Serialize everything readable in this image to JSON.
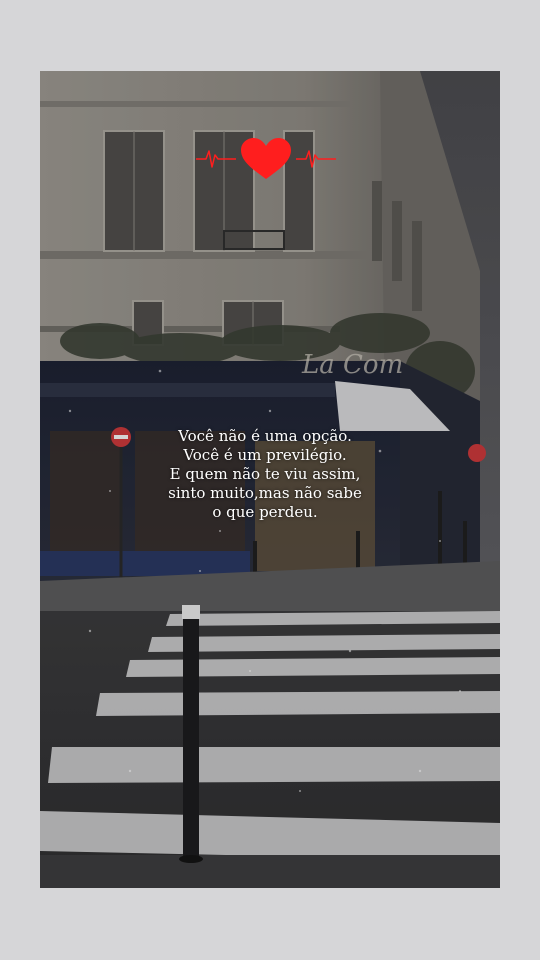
{
  "overlay": {
    "sticker_icon": "heartbeat-heart-icon",
    "accent_color": "#ff1e1e",
    "caption_lines": [
      "Você não é uma opção.",
      "Você é um previlégio.",
      "E quem não te viu assim,",
      "sinto muito,mas não sabe",
      "o que perdeu."
    ]
  },
  "scene": {
    "awning_sign": "La Com"
  }
}
